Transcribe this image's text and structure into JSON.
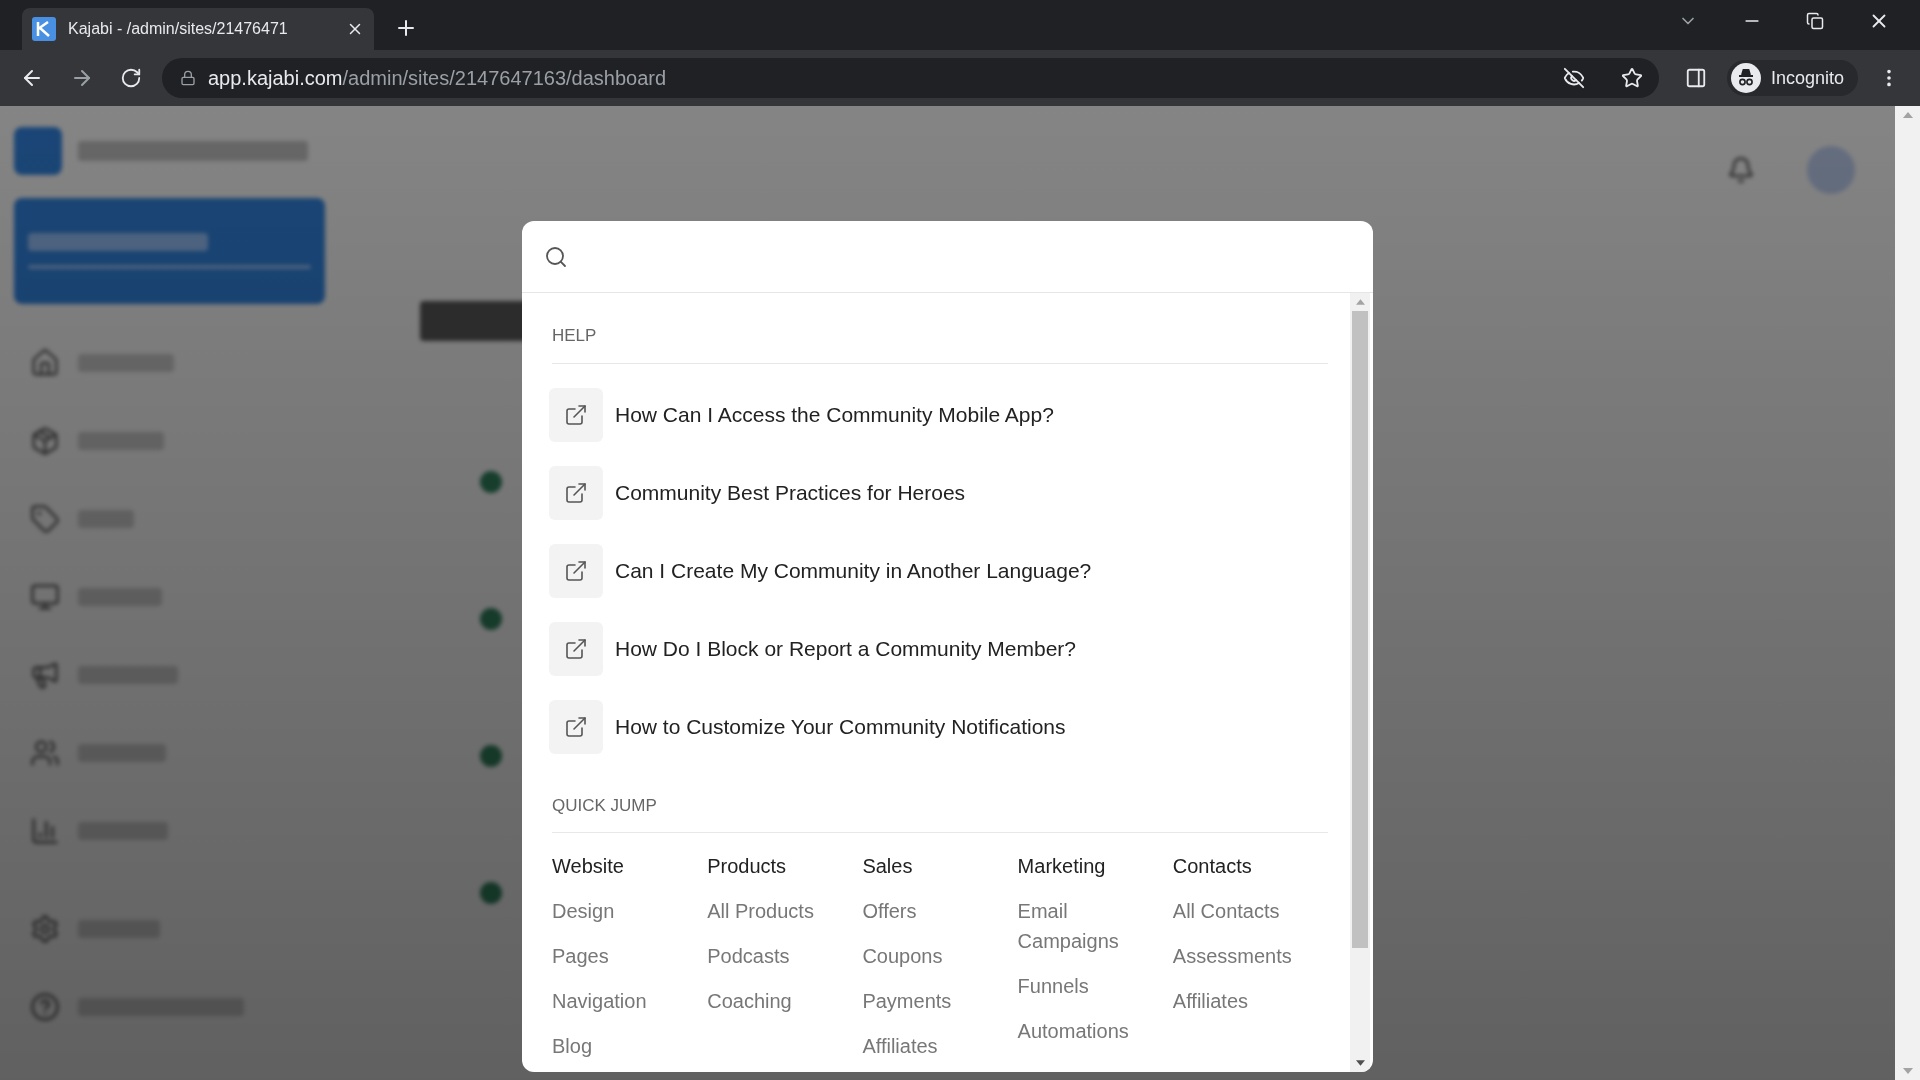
{
  "browser": {
    "tab_title": "Kajabi - /admin/sites/21476471",
    "url_host": "app.kajabi.com",
    "url_path": "/admin/sites/2147647163/dashboard",
    "profile_label": "Incognito"
  },
  "modal": {
    "help": {
      "title": "HELP",
      "articles": [
        {
          "title": "How Can I Access the Community Mobile App?"
        },
        {
          "title": "Community Best Practices for Heroes"
        },
        {
          "title": "Can I Create My Community in Another Language?"
        },
        {
          "title": "How Do I Block or Report a Community Member?"
        },
        {
          "title": "How to Customize Your Community Notifications"
        }
      ]
    },
    "quick_jump": {
      "title": "QUICK JUMP",
      "columns": [
        {
          "heading": "Website",
          "links": [
            "Design",
            "Pages",
            "Navigation",
            "Blog"
          ]
        },
        {
          "heading": "Products",
          "links": [
            "All Products",
            "Podcasts",
            "Coaching"
          ]
        },
        {
          "heading": "Sales",
          "links": [
            "Offers",
            "Coupons",
            "Payments",
            "Affiliates"
          ]
        },
        {
          "heading": "Marketing",
          "links": [
            "Email Campaigns",
            "Funnels",
            "Automations"
          ]
        },
        {
          "heading": "Contacts",
          "links": [
            "All Contacts",
            "Assessments",
            "Affiliates"
          ]
        }
      ]
    }
  }
}
